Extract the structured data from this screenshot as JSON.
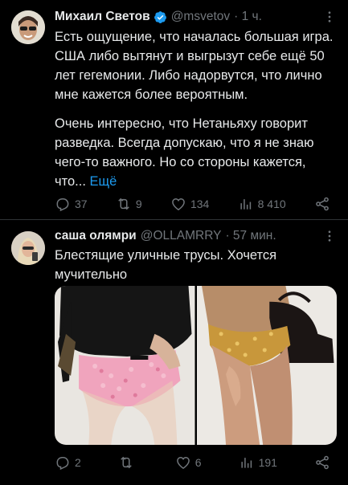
{
  "tweet1": {
    "name": "Михаил Светов",
    "handle": "@msvetov",
    "time": "· 1 ч.",
    "paragraph1": "Есть ощущение, что началась большая игра. США либо вытянут и выгрызут себе ещё 50 лет гегемонии. Либо надорвутся, что лично мне кажется более вероятным.",
    "paragraph2": "Очень интересно, что Нетаньяху говорит разведка. Всегда допускаю, что я не знаю чего-то важного. Но со стороны кажется, что...",
    "show_more": "Ещё",
    "replies": "37",
    "retweets": "9",
    "likes": "134",
    "views": "8 410"
  },
  "tweet2": {
    "name": "саша олямри",
    "handle": "@OLLAMRRY",
    "time": "· 57 мин.",
    "text": "Блестящие уличные трусы. Хочется мучительно",
    "replies": "2",
    "retweets": "",
    "likes": "6",
    "views": "191"
  },
  "colors": {
    "background": "#000000",
    "text": "#e7e9ea",
    "muted": "#71767b",
    "link": "#1d9bf0",
    "verified": "#1d9bf0"
  },
  "icons": [
    "verified-badge-icon",
    "more-icon",
    "reply-icon",
    "retweet-icon",
    "like-icon",
    "views-icon",
    "share-icon"
  ]
}
